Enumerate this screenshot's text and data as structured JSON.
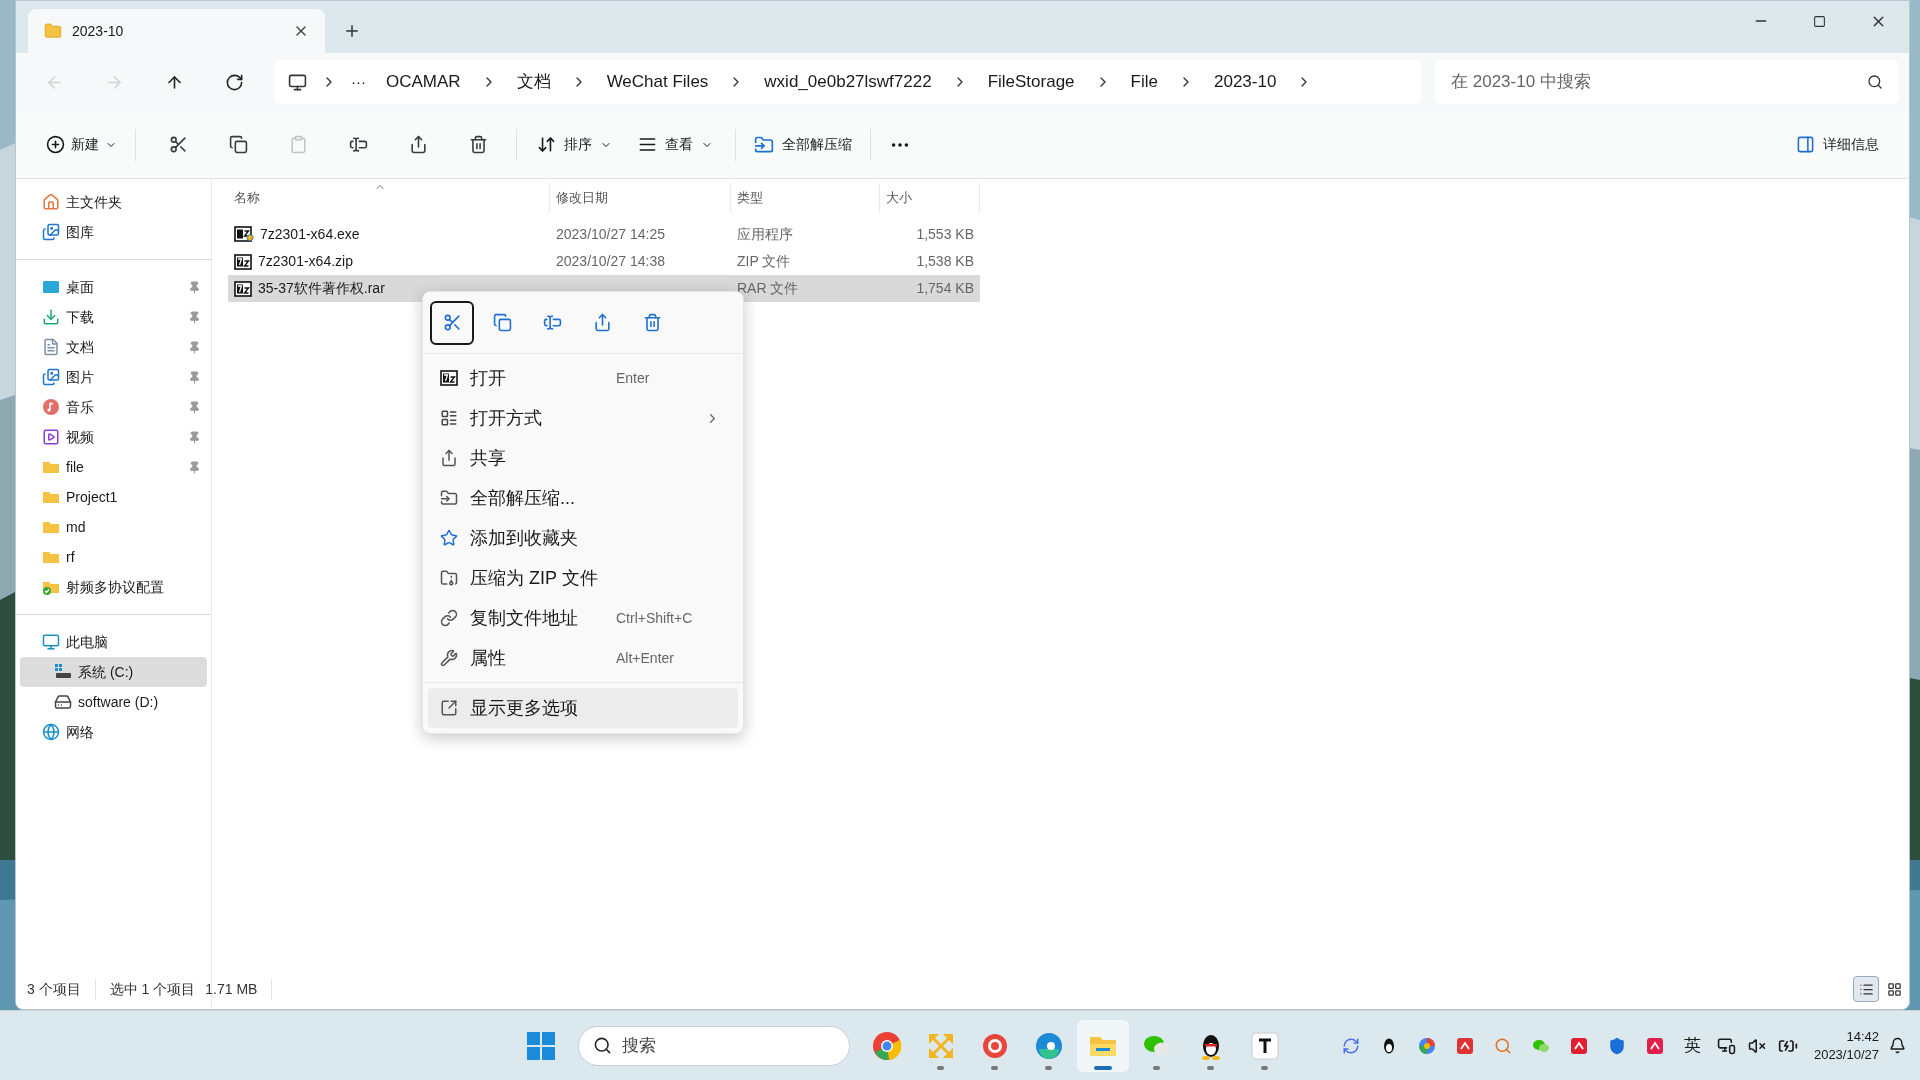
{
  "window": {
    "tab_title": "2023-10"
  },
  "nav_buttons": [
    {
      "kind": "back",
      "disabled": true
    },
    {
      "kind": "forward",
      "disabled": true
    },
    {
      "kind": "up",
      "disabled": false
    },
    {
      "kind": "refresh",
      "disabled": false
    }
  ],
  "address": {
    "more": "···",
    "crumbs": [
      "OCAMAR",
      "文档",
      "WeChat Files",
      "wxid_0e0b27lswf7222",
      "FileStorage",
      "File",
      "2023-10"
    ]
  },
  "search": {
    "placeholder": "在 2023-10 中搜索"
  },
  "toolbar": {
    "new": "新建",
    "icon_buttons": [
      {
        "kind": "cut",
        "disabled": false
      },
      {
        "kind": "copy",
        "disabled": false
      },
      {
        "kind": "paste",
        "disabled": true
      },
      {
        "kind": "rename",
        "disabled": false
      },
      {
        "kind": "share",
        "disabled": false
      },
      {
        "kind": "delete",
        "disabled": false
      }
    ],
    "sort": "排序",
    "view": "查看",
    "extract": "全部解压缩",
    "details": "详细信息"
  },
  "sidebar": {
    "sections": [
      [
        {
          "label": "主文件夹",
          "kind": "home",
          "pinned": false,
          "selected": false
        },
        {
          "label": "图库",
          "kind": "gallery",
          "pinned": false,
          "selected": false
        }
      ],
      [
        {
          "label": "桌面",
          "kind": "desktop",
          "pinned": true,
          "selected": false
        },
        {
          "label": "下载",
          "kind": "download",
          "pinned": true,
          "selected": false
        },
        {
          "label": "文档",
          "kind": "documents",
          "pinned": true,
          "selected": false
        },
        {
          "label": "图片",
          "kind": "pictures",
          "pinned": true,
          "selected": false
        },
        {
          "label": "音乐",
          "kind": "music",
          "pinned": true,
          "selected": false
        },
        {
          "label": "视频",
          "kind": "videos",
          "pinned": true,
          "selected": false
        },
        {
          "label": "file",
          "kind": "folder",
          "pinned": true,
          "selected": false
        },
        {
          "label": "Project1",
          "kind": "folder",
          "pinned": false,
          "selected": false
        },
        {
          "label": "md",
          "kind": "folder",
          "pinned": false,
          "selected": false
        },
        {
          "label": "rf",
          "kind": "folder",
          "pinned": false,
          "selected": false
        },
        {
          "label": "射频多协议配置",
          "kind": "folder-synced",
          "pinned": false,
          "selected": false
        }
      ],
      [
        {
          "label": "此电脑",
          "kind": "pc",
          "pinned": false,
          "selected": false,
          "children": [
            {
              "label": "系统 (C:)",
              "kind": "drive-system",
              "pinned": false,
              "selected": true
            },
            {
              "label": "software (D:)",
              "kind": "drive",
              "pinned": false,
              "selected": false
            }
          ]
        },
        {
          "label": "网络",
          "kind": "network",
          "pinned": false,
          "selected": false
        }
      ]
    ]
  },
  "files": {
    "columns": [
      "名称",
      "修改日期",
      "类型",
      "大小"
    ],
    "rows": [
      {
        "name": "7z2301-x64.exe",
        "kind": "exe",
        "date": "2023/10/27 14:25",
        "type": "应用程序",
        "size": "1,553 KB",
        "selected": false
      },
      {
        "name": "7z2301-x64.zip",
        "kind": "archive",
        "date": "2023/10/27 14:38",
        "type": "ZIP 文件",
        "size": "1,538 KB",
        "selected": false
      },
      {
        "name": "35-37软件著作权.rar",
        "kind": "archive",
        "type": "RAR 文件",
        "size": "1,754 KB",
        "selected": true
      }
    ]
  },
  "context_menu": {
    "quick_actions": [
      {
        "kind": "cut",
        "selected": true
      },
      {
        "kind": "copy",
        "selected": false
      },
      {
        "kind": "rename",
        "selected": false
      },
      {
        "kind": "share",
        "selected": false
      },
      {
        "kind": "delete",
        "selected": false
      }
    ],
    "items": [
      {
        "label": "打开",
        "kind": "open",
        "shortcut": "Enter",
        "submenu": false,
        "selected": false
      },
      {
        "label": "打开方式",
        "kind": "open-with",
        "submenu": true,
        "selected": false
      },
      {
        "label": "共享",
        "kind": "share",
        "submenu": false,
        "selected": false
      },
      {
        "label": "全部解压缩...",
        "kind": "extract",
        "submenu": false,
        "selected": false
      },
      {
        "label": "添加到收藏夹",
        "kind": "favorite",
        "submenu": false,
        "selected": false
      },
      {
        "label": "压缩为 ZIP 文件",
        "kind": "zip",
        "submenu": false,
        "selected": false
      },
      {
        "label": "复制文件地址",
        "kind": "copy-path",
        "shortcut": "Ctrl+Shift+C",
        "submenu": false,
        "selected": false
      },
      {
        "label": "属性",
        "kind": "properties",
        "shortcut": "Alt+Enter",
        "submenu": false,
        "selected": false
      }
    ],
    "more": {
      "label": "显示更多选项",
      "selected": true
    }
  },
  "status_bar": {
    "count": "3 个项目",
    "selection": "选中 1 个项目",
    "size": "1.71 MB",
    "views": [
      {
        "kind": "details",
        "selected": true
      },
      {
        "kind": "tiles",
        "selected": false
      }
    ]
  },
  "taskbar": {
    "search_placeholder": "搜索",
    "apps": [
      {
        "kind": "chrome",
        "running": false,
        "selected": false
      },
      {
        "kind": "tool",
        "running": true,
        "selected": false
      },
      {
        "kind": "bird",
        "running": true,
        "selected": false
      },
      {
        "kind": "edge",
        "running": true,
        "selected": false
      },
      {
        "kind": "explorer",
        "running": true,
        "selected": true
      },
      {
        "kind": "wechat",
        "running": true,
        "selected": false
      },
      {
        "kind": "qq",
        "running": true,
        "selected": false
      },
      {
        "kind": "typora",
        "running": true,
        "selected": false
      }
    ],
    "tray": [
      {
        "kind": "sync"
      },
      {
        "kind": "qq"
      },
      {
        "kind": "colorful"
      },
      {
        "kind": "mail"
      },
      {
        "kind": "search"
      },
      {
        "kind": "wechat"
      },
      {
        "kind": "youdao"
      },
      {
        "kind": "shield"
      },
      {
        "kind": "pdf"
      }
    ],
    "ime": "英",
    "time": "14:42",
    "date": "2023/10/27"
  }
}
